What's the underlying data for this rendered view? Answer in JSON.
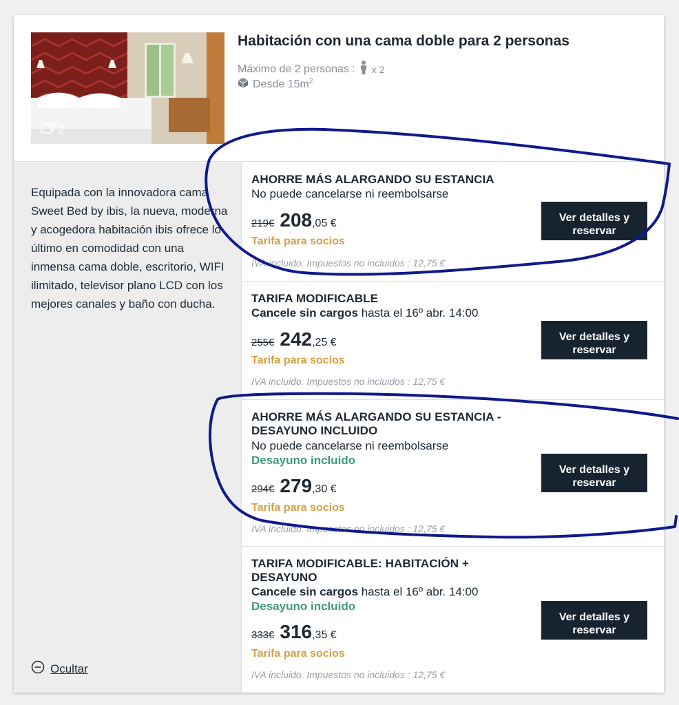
{
  "room": {
    "title": "Habitación con una cama doble para 2 personas",
    "max_persons": "Máximo de 2 personas :",
    "persons_icon": "person-icon",
    "persons_count": "x 2",
    "size_prefix": "Desde 15m",
    "size_sup": "2",
    "photo_count": "2",
    "description": "Equipada con la innovadora cama Sweet Bed by ibis, la nueva, moderna y acogedora habitación ibis ofrece lo último en comodidad con una inmensa cama doble, escritorio, WIFI ilimitado, televisor plano LCD con los mejores canales y baño con ducha.",
    "hide_label": "Ocultar"
  },
  "rates": [
    {
      "name": "AHORRE MÁS ALARGANDO SU ESTANCIA",
      "condition": "No puede cancelarse ni reembolsarse",
      "old_price": "219€",
      "price_int": "208",
      "price_dec": ",05 €",
      "member_label": "Tarifa para socios",
      "tax_note": "IVA incluido. Impuestos no incluidos : 12,75 €",
      "button": "Ver detalles y reservar"
    },
    {
      "name": "TARIFA MODIFICABLE",
      "cancel_bold": "Cancele sin cargos",
      "cancel_rest": " hasta el 16º abr. 14:00",
      "old_price": "255€",
      "price_int": "242",
      "price_dec": ",25 €",
      "member_label": "Tarifa para socios",
      "tax_note": "IVA incluido. Impuestos no incluidos : 12,75 €",
      "button": "Ver detalles y reservar"
    },
    {
      "name_line1": "AHORRE MÁS ALARGANDO SU ESTANCIA -",
      "name_line2": "DESAYUNO INCLUIDO",
      "condition": "No puede cancelarse ni reembolsarse",
      "breakfast": "Desayuno incluido",
      "old_price": "294€",
      "price_int": "279",
      "price_dec": ",30 €",
      "member_label": "Tarifa para socios",
      "tax_note": "IVA incluido. Impuestos no incluidos : 12,75 €",
      "button": "Ver detalles y reservar"
    },
    {
      "name_line1": "TARIFA MODIFICABLE: HABITACIÓN +",
      "name_line2": "DESAYUNO",
      "cancel_bold": "Cancele sin cargos",
      "cancel_rest": " hasta el 16º abr. 14:00",
      "breakfast": "Desayuno incluido",
      "old_price": "333€",
      "price_int": "316",
      "price_dec": ",35 €",
      "member_label": "Tarifa para socios",
      "tax_note": "IVA incluido. Impuestos no incluidos : 12,75 €",
      "button": "Ver detalles y reservar"
    }
  ],
  "colors": {
    "button_bg": "#172430",
    "member_gold": "#d4a043",
    "breakfast_green": "#3a9b74",
    "annotation_blue": "#0f1a8c"
  }
}
